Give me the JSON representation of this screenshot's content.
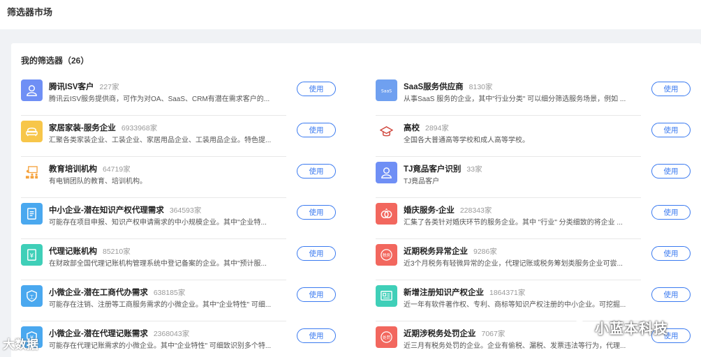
{
  "page": {
    "title": "筛选器市场"
  },
  "panel": {
    "title": "我的筛选器（26）"
  },
  "use_label": "使用",
  "filters_left": [
    {
      "name": "腾讯ISV客户",
      "count": "227家",
      "desc": "腾讯云ISV服务提供商，可作为对OA、SaaS、CRM有潜在需求客户的...",
      "icon": "user-icon",
      "color": "#6f8ff5"
    },
    {
      "name": "家居家装-服务企业",
      "count": "6933968家",
      "desc": "汇聚各类家装企业、工装企业、家居用品企业、工装用品企业。特色提...",
      "icon": "sofa-icon",
      "color": "#f7c64a"
    },
    {
      "name": "教育培训机构",
      "count": "64719家",
      "desc": "有电销团队的教育、培训机构。",
      "icon": "classroom-icon",
      "color": "#ffffff"
    },
    {
      "name": "中小企业-潜在知识产权代理需求",
      "count": "364593家",
      "desc": "可能存在项目申报、知识产权申请需求的中小规模企业。其中\"企业特...",
      "icon": "document-icon",
      "color": "#4aa8ef"
    },
    {
      "name": "代理记账机构",
      "count": "85210家",
      "desc": "在财政部全国代理记账机构管理系统中登记备案的企业。其中\"预计服...",
      "icon": "ledger-icon",
      "color": "#3fcfb8"
    },
    {
      "name": "小微企业-潜在工商代办需求",
      "count": "638185家",
      "desc": "可能存在注销、注册等工商服务需求的小微企业。其中\"企业特性\" 可细...",
      "icon": "shield-icon",
      "color": "#4aa8ef"
    },
    {
      "name": "小微企业-潜在代理记账需求",
      "count": "2368043家",
      "desc": "可能存在代理记账需求的小微企业。其中\"企业特性\" 可细致识别多个特...",
      "icon": "yen-shield-icon",
      "color": "#4aa8ef"
    }
  ],
  "filters_right": [
    {
      "name": "SaaS服务供应商",
      "count": "8130家",
      "desc": "从事SaaS 服务的企业，其中\"行业分类\" 可以细分筛选服务场景，例如 ...",
      "icon": "saas-icon",
      "color": "#6fa0f0"
    },
    {
      "name": "高校",
      "count": "2894家",
      "desc": "全国各大普通高等学校和成人高等学校。",
      "icon": "graduation-cap-icon",
      "color": "#ffffff"
    },
    {
      "name": "TJ竟品客户识别",
      "count": "33家",
      "desc": "TJ竟品客户",
      "icon": "user-icon",
      "color": "#6f8ff5"
    },
    {
      "name": "婚庆服务-企业",
      "count": "228343家",
      "desc": "汇集了各类针对婚庆环节的服务企业。其中 \"行业\" 分类细致的将企业 ...",
      "icon": "rings-icon",
      "color": "#f2675e"
    },
    {
      "name": "近期税务异常企业",
      "count": "9286家",
      "desc": "近3个月税务有轻微异常的企业，代理记账或税务筹划类服务企业可尝...",
      "icon": "tax-icon",
      "color": "#f2675e"
    },
    {
      "name": "新增注册知识产权企业",
      "count": "1864371家",
      "desc": "近一年有软件著作权、专利、商标等知识产权注册的中小企业。可挖掘...",
      "icon": "certificate-icon",
      "color": "#3fcfb8"
    },
    {
      "name": "近期涉税务处罚企业",
      "count": "7067家",
      "desc": "近三月有税务处罚的企业。企业有偷税、漏税、发票违法等行为，代理...",
      "icon": "penalty-icon",
      "color": "#f2675e"
    }
  ],
  "watermark": {
    "text": "小蓝本科技",
    "left_text": "大数据"
  }
}
